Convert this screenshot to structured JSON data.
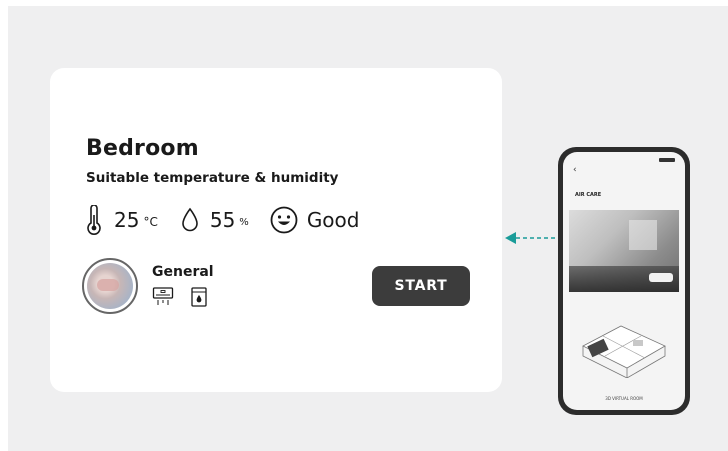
{
  "card": {
    "title": "Bedroom",
    "subtitle": "Suitable temperature & humidity",
    "stats": {
      "temperature": {
        "value": "25",
        "unit": "°C",
        "icon": "thermometer-icon"
      },
      "humidity": {
        "value": "55",
        "unit": "%",
        "icon": "droplet-icon"
      },
      "air_quality": {
        "value": "Good",
        "icon": "smiley-face-icon"
      }
    },
    "mode": {
      "name": "General",
      "avatar": "bedroom-photo",
      "icons": [
        "air-conditioner-icon",
        "air-purifier-icon"
      ]
    },
    "start_label": "START"
  },
  "connector": {
    "icon": "dashed-arrow-left-icon",
    "color": "#1a9c99"
  },
  "phone": {
    "header": "AIR CARE",
    "footer": "3D VIRTUAL ROOM"
  },
  "colors": {
    "background": "#efeff0",
    "card": "#ffffff",
    "button": "#3c3c3c",
    "accent": "#1a9c99"
  }
}
